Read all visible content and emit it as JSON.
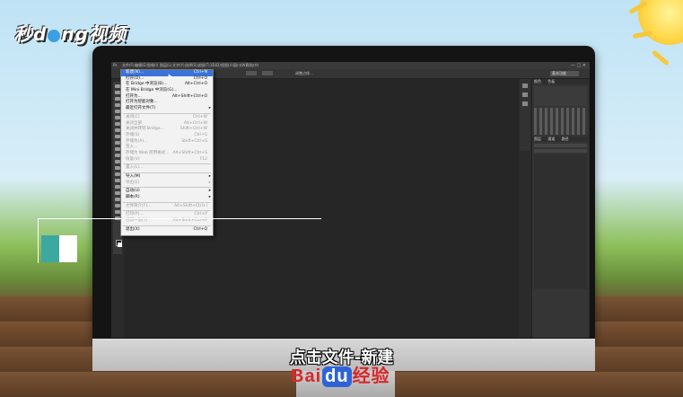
{
  "watermark": {
    "logo_text_left": "秒",
    "logo_text_mid": "d",
    "logo_text_right": "ng视频"
  },
  "photoshop": {
    "menubar": [
      "Ps",
      "文件(F)",
      "编辑(E)",
      "图像(I)",
      "图层(L)",
      "文字(Y)",
      "选择(S)",
      "滤镜(T)",
      "3D(D)",
      "视图(V)",
      "窗口(W)",
      "帮助(H)"
    ],
    "window_controls": "— □ ✕",
    "options_text": "调整边缘...",
    "workspace_preset": "基本功能",
    "right_panel_tabs": [
      "颜色",
      "色板"
    ],
    "layers_tabs": [
      "图层",
      "通道",
      "路径"
    ]
  },
  "file_menu": {
    "items": [
      {
        "label": "新建(N)...",
        "shortcut": "Ctrl+N",
        "highlight": true
      },
      {
        "label": "打开(O)...",
        "shortcut": "Ctrl+O"
      },
      {
        "label": "在 Bridge 中浏览(B)...",
        "shortcut": "Alt+Ctrl+O"
      },
      {
        "label": "在 Mini Bridge 中浏览(G)...",
        "shortcut": ""
      },
      {
        "label": "打开为...",
        "shortcut": "Alt+Shift+Ctrl+O"
      },
      {
        "label": "打开为智能对象...",
        "shortcut": ""
      },
      {
        "label": "最近打开文件(T)",
        "shortcut": "",
        "submenu": true
      },
      {
        "sep": true
      },
      {
        "label": "关闭(C)",
        "shortcut": "Ctrl+W",
        "disabled": true
      },
      {
        "label": "关闭全部",
        "shortcut": "Alt+Ctrl+W",
        "disabled": true
      },
      {
        "label": "关闭并转到 Bridge...",
        "shortcut": "Shift+Ctrl+W",
        "disabled": true
      },
      {
        "label": "存储(S)",
        "shortcut": "Ctrl+S",
        "disabled": true
      },
      {
        "label": "存储为(A)...",
        "shortcut": "Shift+Ctrl+S",
        "disabled": true
      },
      {
        "label": "签入...",
        "shortcut": "",
        "disabled": true
      },
      {
        "label": "存储为 Web 所用格式...",
        "shortcut": "Alt+Shift+Ctrl+S",
        "disabled": true
      },
      {
        "label": "恢复(V)",
        "shortcut": "F12",
        "disabled": true
      },
      {
        "sep": true
      },
      {
        "label": "置入(L)...",
        "shortcut": "",
        "disabled": true
      },
      {
        "sep": true
      },
      {
        "label": "导入(M)",
        "shortcut": "",
        "submenu": true
      },
      {
        "label": "导出(E)",
        "shortcut": "",
        "submenu": true,
        "disabled": true
      },
      {
        "sep": true
      },
      {
        "label": "自动(U)",
        "shortcut": "",
        "submenu": true
      },
      {
        "label": "脚本(R)",
        "shortcut": "",
        "submenu": true
      },
      {
        "sep": true
      },
      {
        "label": "文件简介(F)...",
        "shortcut": "Alt+Shift+Ctrl+I",
        "disabled": true
      },
      {
        "sep": true
      },
      {
        "label": "打印(P)...",
        "shortcut": "Ctrl+P",
        "disabled": true
      },
      {
        "label": "打印一份(Y)",
        "shortcut": "Alt+Shift+Ctrl+P",
        "disabled": true
      },
      {
        "sep": true
      },
      {
        "label": "退出(X)",
        "shortcut": "Ctrl+Q"
      }
    ]
  },
  "caption": "点击文件-新建",
  "baidu": {
    "left": "Bai",
    "du": "du",
    "right": "经验"
  },
  "colors": {
    "menu_highlight": "#3b74d8",
    "caption_fill": "#ffffff",
    "baidu_red": "#d8282b",
    "baidu_blue": "#2f64d8",
    "teal": "#3ca8a0"
  }
}
